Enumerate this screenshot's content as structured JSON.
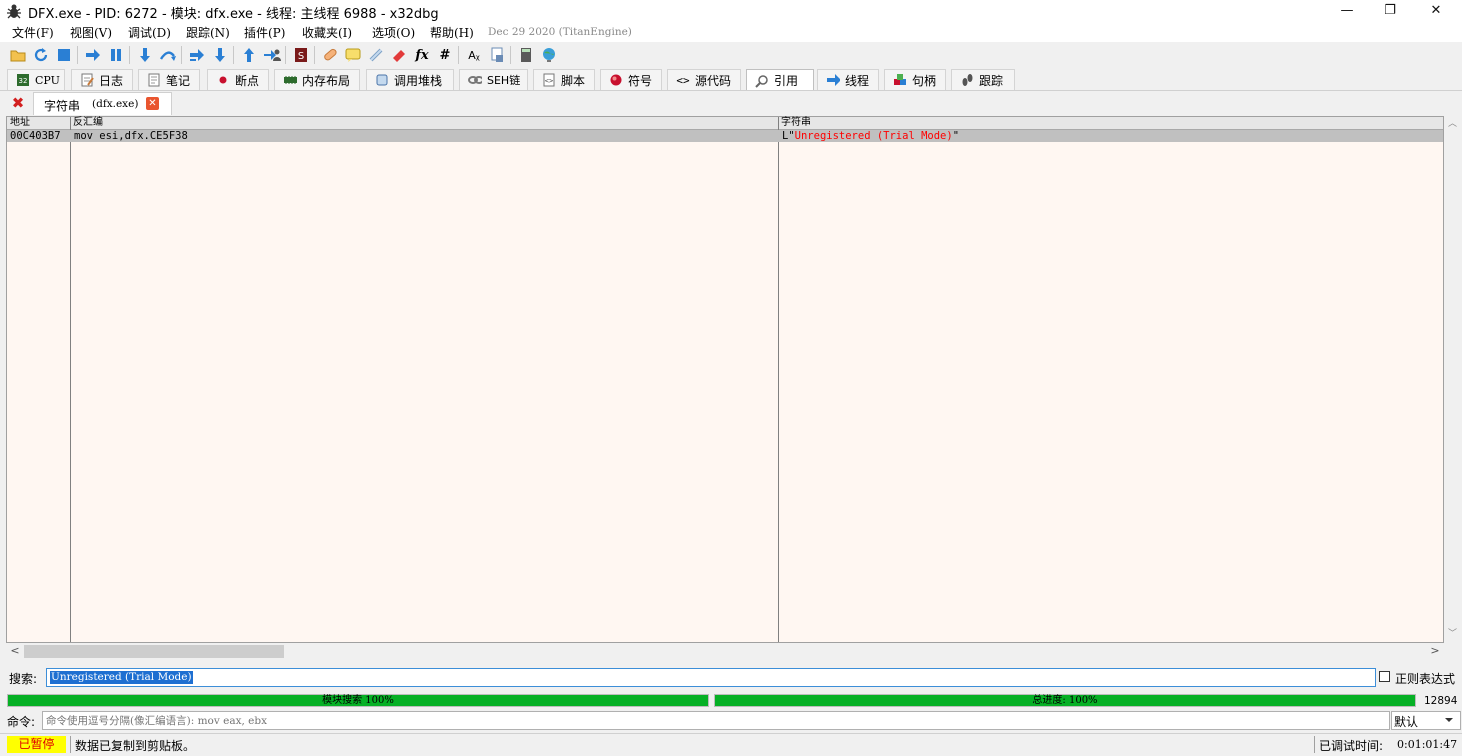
{
  "window": {
    "title": "DFX.exe - PID: 6272 - 模块: dfx.exe - 线程: 主线程 6988 - x32dbg",
    "minimize_glyph": "—",
    "restore_glyph": "❐",
    "close_glyph": "✕"
  },
  "menu": {
    "items": [
      "文件(F)",
      "视图(V)",
      "调试(D)",
      "跟踪(N)",
      "插件(P)",
      "收藏夹(I)",
      "选项(O)",
      "帮助(H)"
    ],
    "build_info": "Dec 29 2020 (TitanEngine)"
  },
  "toolbar": {
    "icons": [
      "open-icon",
      "restart-icon",
      "stop-icon",
      "run-icon",
      "pause-icon",
      "step-into-icon",
      "step-over-icon",
      "trace-into-icon",
      "trace-over-icon",
      "execute-till-return-icon",
      "run-to-user-code-icon",
      "scylla-icon",
      "patch-icon",
      "comment-icon",
      "label-icon",
      "bookmark-icon",
      "function-icon",
      "hash-icon",
      "font-icon",
      "strings-icon",
      "calculator-icon",
      "globe-icon"
    ],
    "fx_glyph": "fx",
    "hash_glyph": "#",
    "font_glyph": "Aᵪ"
  },
  "tabs": [
    {
      "label": "CPU",
      "icon": "cpu-icon"
    },
    {
      "label": "日志",
      "icon": "log-icon"
    },
    {
      "label": "笔记",
      "icon": "notes-icon"
    },
    {
      "label": "断点",
      "icon": "breakpoint-icon"
    },
    {
      "label": "内存布局",
      "icon": "memory-map-icon"
    },
    {
      "label": "调用堆栈",
      "icon": "call-stack-icon"
    },
    {
      "label": "SEH链",
      "icon": "seh-chain-icon"
    },
    {
      "label": "脚本",
      "icon": "script-icon"
    },
    {
      "label": "符号",
      "icon": "symbols-icon"
    },
    {
      "label": "源代码",
      "icon": "source-icon"
    },
    {
      "label": "引用",
      "icon": "references-icon",
      "active": true
    },
    {
      "label": "线程",
      "icon": "threads-icon"
    },
    {
      "label": "句柄",
      "icon": "handles-icon"
    },
    {
      "label": "跟踪",
      "icon": "trace-icon"
    }
  ],
  "subtab": {
    "close_all_glyph": "✖",
    "title": "字符串",
    "module": "(dfx.exe)",
    "close_glyph": "✕"
  },
  "table": {
    "columns": [
      "地址",
      "反汇编",
      "字符串"
    ],
    "rows": [
      {
        "address": "00C403B7",
        "disasm": "mov esi,dfx.CE5F38",
        "string_prefix": "L\"",
        "string_value": "Unregistered (Trial Mode)",
        "string_suffix": "\""
      }
    ]
  },
  "scroll": {
    "up": "︿",
    "down": "﹀",
    "left": "<",
    "right": ">"
  },
  "search": {
    "label": "搜索:",
    "value": "Unregistered (Trial Mode)",
    "regex_label": "正则表达式",
    "regex_checked": false
  },
  "progress": {
    "module_label": "模块搜索 100%",
    "module_percent": 100,
    "total_label": "总进度: 100%",
    "total_percent": 100,
    "count": "12894"
  },
  "command": {
    "label": "命令:",
    "placeholder": "命令使用逗号分隔(像汇编语言): mov eax, ebx",
    "mode": "默认"
  },
  "status": {
    "state": "已暂停",
    "message": "数据已复制到剪贴板。",
    "debug_time_label": "已调试时间:",
    "debug_time": "0:01:01:47"
  },
  "colors": {
    "table_bg": "#fff7f2",
    "selected_row": "#c0c0c0",
    "string_red": "#ff0000",
    "progress_green": "#06b025",
    "paused_yellow": "#ffff00"
  }
}
